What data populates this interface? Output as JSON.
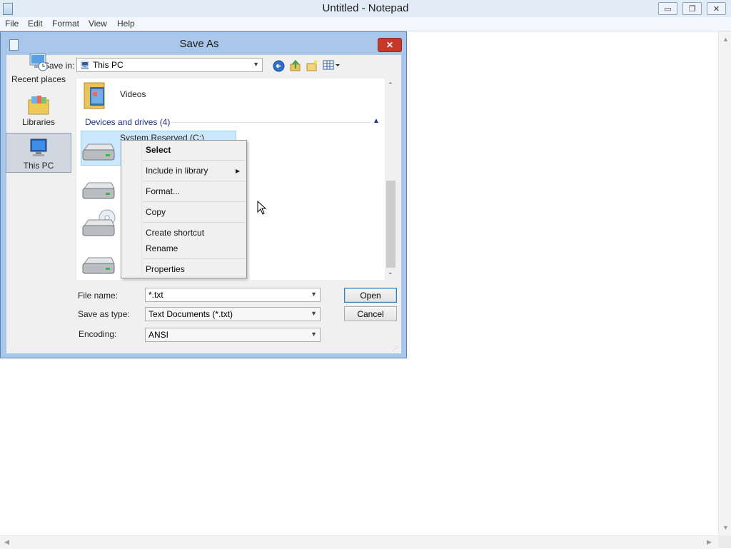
{
  "notepad": {
    "title": "Untitled - Notepad",
    "menu": [
      "File",
      "Edit",
      "Format",
      "View",
      "Help"
    ],
    "controls": {
      "minimize": "▭",
      "restore": "❐",
      "close": "✕"
    }
  },
  "dialog": {
    "title": "Save As",
    "close": "✕",
    "save_in_label": "Save in:",
    "save_in_value": "This PC",
    "places": [
      {
        "label": "Recent places",
        "icon": "recent-places-icon"
      },
      {
        "label": "Libraries",
        "icon": "libraries-icon"
      },
      {
        "label": "This PC",
        "icon": "this-pc-icon"
      }
    ],
    "filelist": {
      "top_item": "Videos",
      "group_header": "Devices and drives (4)",
      "selected_drive": "System Reserved (C:)"
    },
    "context_menu": [
      "Select",
      "Include in library",
      "Format...",
      "Copy",
      "Create shortcut",
      "Rename",
      "Properties"
    ],
    "file_name_label": "File name:",
    "file_name_value": "*.txt",
    "type_label": "Save as type:",
    "type_value": "Text Documents (*.txt)",
    "encoding_label": "Encoding:",
    "encoding_value": "ANSI",
    "open_button": "Open",
    "cancel_button": "Cancel"
  },
  "colors": {
    "accent": "#3c7fb1",
    "selection": "#cce8ff",
    "titlebar": "#a9c7ea",
    "close": "#c7382a"
  }
}
